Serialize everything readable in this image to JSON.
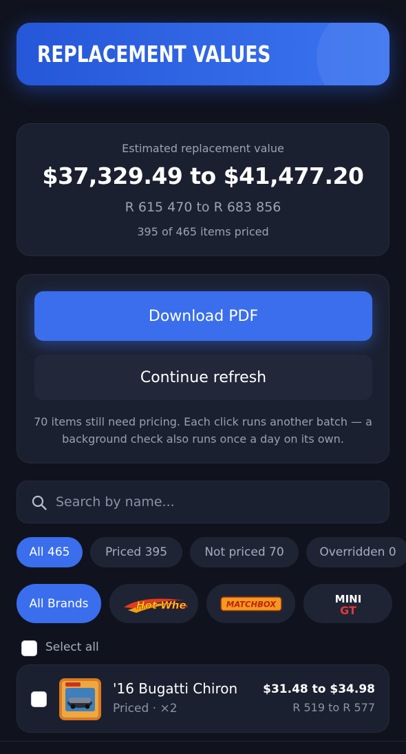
{
  "header": {
    "title": "REPLACEMENT VALUES"
  },
  "summary": {
    "label": "Estimated replacement value",
    "range_usd": "$37,329.49 to $41,477.20",
    "range_zar": "R 615 470 to R 683 856",
    "count": "395 of 465 items priced"
  },
  "actions": {
    "download_label": "Download PDF",
    "refresh_label": "Continue refresh",
    "note": "70 items still need pricing. Each click runs another batch — a background check also runs once a day on its own."
  },
  "search": {
    "placeholder": "Search by name..."
  },
  "filters": [
    {
      "label": "All 465",
      "active": true
    },
    {
      "label": "Priced 395",
      "active": false
    },
    {
      "label": "Not priced 70",
      "active": false
    },
    {
      "label": "Overridden 0",
      "active": false
    }
  ],
  "brands": {
    "all_label": "All Brands",
    "logos": [
      "Hot Wheels",
      "MATCHBOX",
      "MINI GT"
    ]
  },
  "select_all": {
    "label": "Select all",
    "checked": false
  },
  "items": [
    {
      "name": "'16 Bugatti Chiron",
      "status": "Priced · ×2",
      "price_usd": "$31.48 to $34.98",
      "price_zar": "R 519 to R 577",
      "checked": false
    }
  ],
  "colors": {
    "background": "#10131e",
    "card": "#1b2030",
    "accent": "#3a6eec",
    "muted_text": "#9ca3b4"
  }
}
